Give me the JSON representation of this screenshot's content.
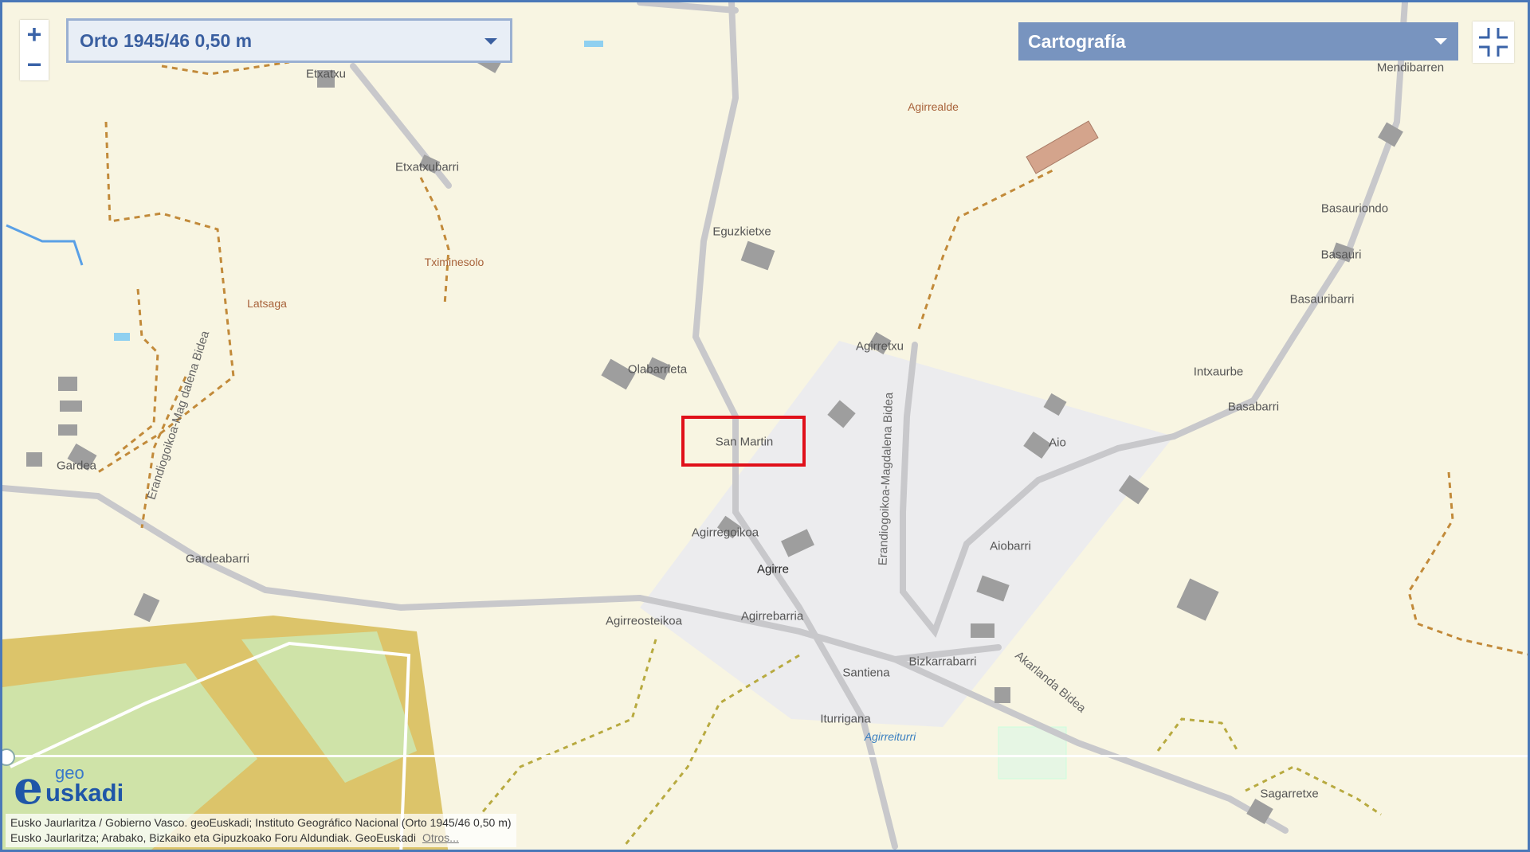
{
  "controls": {
    "zoom_in": "+",
    "zoom_out": "−",
    "layer_select": "Orto 1945/46 0,50 m",
    "cartography_select": "Cartografía"
  },
  "logo": {
    "geo": "geo",
    "e": "e",
    "uskadi": "uskadi"
  },
  "attribution": {
    "line1": "Eusko Jaurlaritza / Gobierno Vasco. geoEuskadi; Instituto Geográfico Nacional (Orto 1945/46 0,50 m)",
    "line2": "Eusko Jaurlaritza; Arabako, Bizkaiko eta Gipuzkoako Foru Aldundiak. GeoEuskadi",
    "more": "Otros..."
  },
  "places": {
    "etxatxu": "Etxatxu",
    "etxatxubarri": "Etxatxubarri",
    "tximinesolo": "Tximinesolo",
    "latsaga": "Latsaga",
    "eguzkietxe": "Eguzkietxe",
    "agirrealde": "Agirrealde",
    "mendibarren": "Mendibarren",
    "basauriondo": "Basauriondo",
    "basauri": "Basauri",
    "basauribarri": "Basauribarri",
    "intxaurbe": "Intxaurbe",
    "basabarri": "Basabarri",
    "agirretxu": "Agirretxu",
    "olabarrieta": "Olabarrieta",
    "san_martin": "San Martin",
    "aio": "Aio",
    "gardea": "Gardea",
    "gardeabarri": "Gardeabarri",
    "agirregoikoa": "Agirregoikoa",
    "agirre": "Agirre",
    "aiobarri": "Aiobarri",
    "agirreosteikoa": "Agirreosteikoa",
    "agirrebarria": "Agirrebarria",
    "santiena": "Santiena",
    "bizkarrabarri": "Bizkarrabarri",
    "iturrigana": "Iturrigana",
    "agirreiturri": "Agirreiturri",
    "sagarretxe": "Sagarretxe"
  },
  "roads": {
    "erandiogoikoa_mag": "Erandiogoikoa-Mag dalena Bidea",
    "erandiogoikoa_magdalena": "Erandiogoikoa-Magdalena Bidea",
    "akarlanda": "Akarlanda Bidea"
  },
  "highlight": "San Martin"
}
